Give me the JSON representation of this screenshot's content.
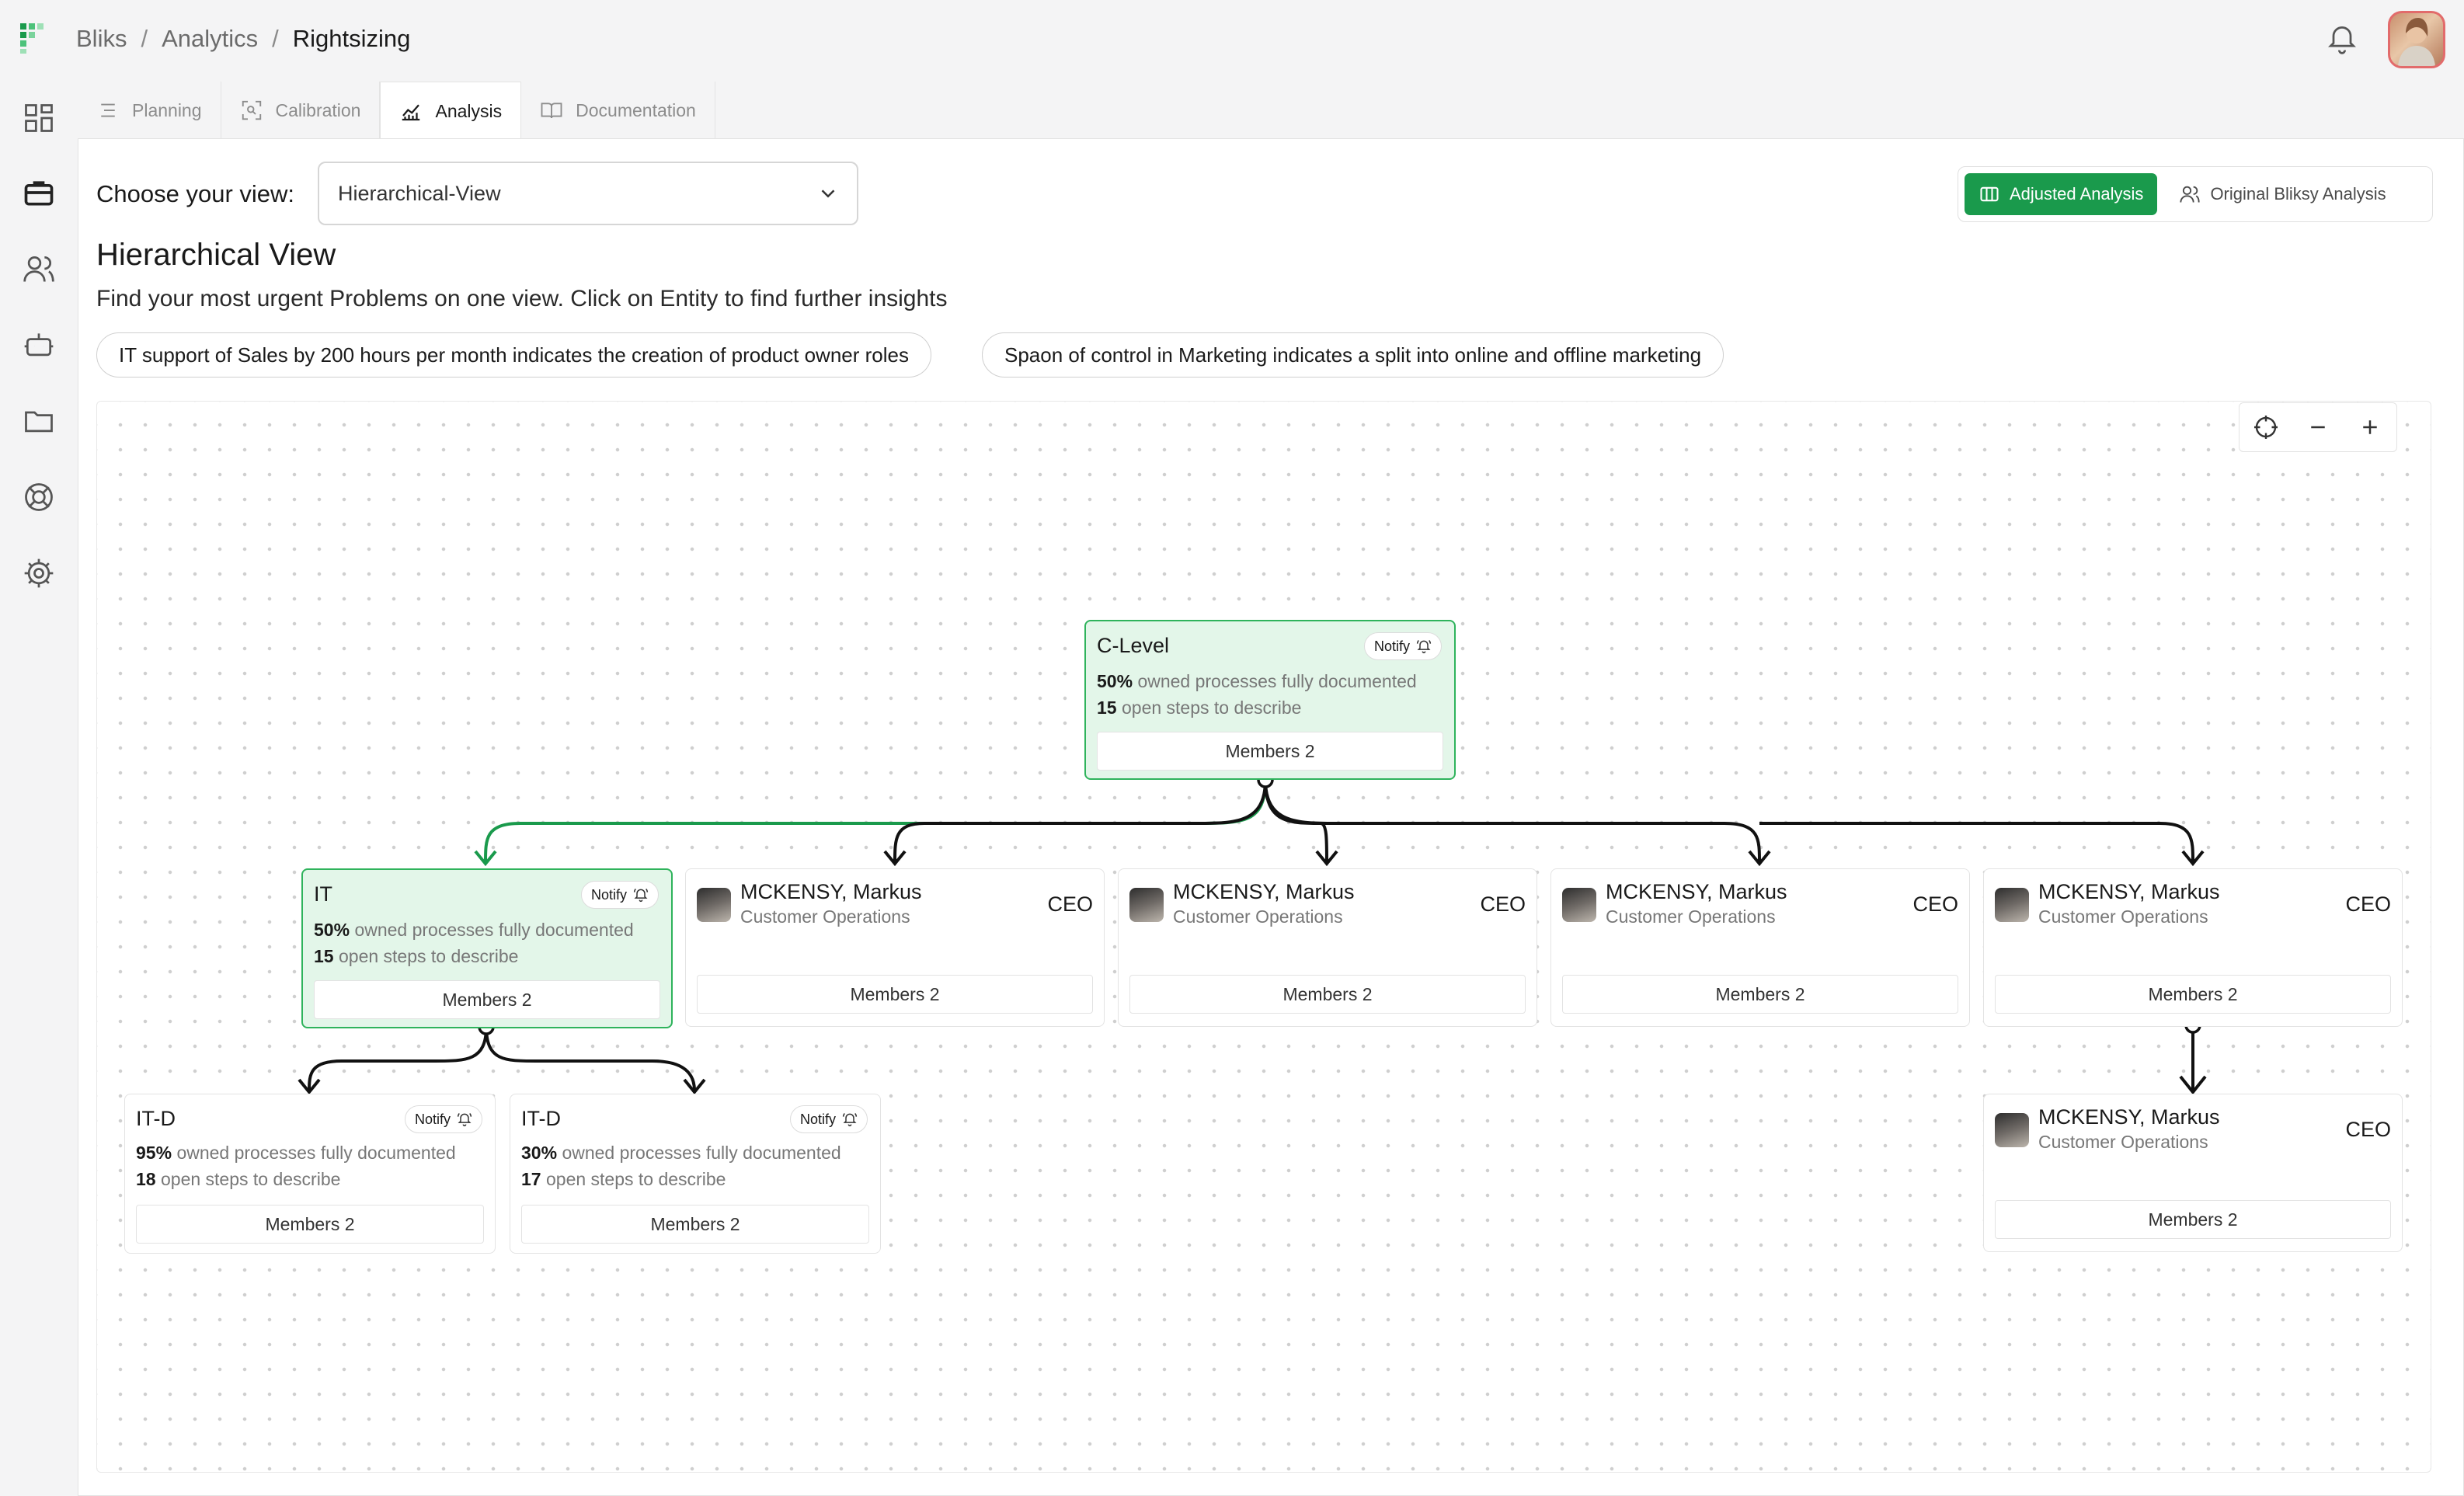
{
  "breadcrumb": {
    "items": [
      "Bliks",
      "Analytics"
    ],
    "current": "Rightsizing",
    "separator": "/"
  },
  "tabs": [
    {
      "label": "Planning",
      "icon": "list-icon",
      "active": false
    },
    {
      "label": "Calibration",
      "icon": "scan-icon",
      "active": false
    },
    {
      "label": "Analysis",
      "icon": "chart-icon",
      "active": true
    },
    {
      "label": "Documentation",
      "icon": "book-icon",
      "active": false
    }
  ],
  "sidebar": {
    "icons": [
      "dashboard-icon",
      "briefcase-icon",
      "users-icon",
      "bot-icon",
      "folder-icon",
      "lifebuoy-icon",
      "settings-icon"
    ]
  },
  "view": {
    "label": "Choose your view:",
    "selected": "Hierarchical-View"
  },
  "toggle": {
    "adjusted": "Adjusted Analysis",
    "original": "Original Bliksy Analysis"
  },
  "heading": "Hierarchical View",
  "subheading": "Find your most urgent Problems on one view. Click on Entity to find further insights",
  "insights": [
    "IT support of Sales by 200 hours per month indicates the creation of product owner roles",
    "Spaon of control in Marketing indicates a split into online and offline marketing"
  ],
  "colors": {
    "accent": "#1a9a4c",
    "node_green_bg": "#e3f6e9",
    "node_green_border": "#2fb35c"
  },
  "nodes": {
    "clevel": {
      "title": "C-Level",
      "notify": "Notify",
      "pct": "50%",
      "pct_text": "owned processes fully documented",
      "steps": "15",
      "steps_text": "open steps to describe",
      "members": "Members 2"
    },
    "it": {
      "title": "IT",
      "notify": "Notify",
      "pct": "50%",
      "pct_text": "owned processes fully documented",
      "steps": "15",
      "steps_text": "open steps to describe",
      "members": "Members 2"
    },
    "itd1": {
      "title": "IT-D",
      "notify": "Notify",
      "pct": "95%",
      "pct_text": "owned processes fully documented",
      "steps": "18",
      "steps_text": "open steps to describe",
      "members": "Members 2"
    },
    "itd2": {
      "title": "IT-D",
      "notify": "Notify",
      "pct": "30%",
      "pct_text": "owned processes fully documented",
      "steps": "17",
      "steps_text": "open steps to describe",
      "members": "Members 2"
    },
    "people": [
      {
        "name": "MCKENSY, Markus",
        "dept": "Customer Operations",
        "role": "CEO",
        "members": "Members 2"
      },
      {
        "name": "MCKENSY, Markus",
        "dept": "Customer Operations",
        "role": "CEO",
        "members": "Members 2"
      },
      {
        "name": "MCKENSY, Markus",
        "dept": "Customer Operations",
        "role": "CEO",
        "members": "Members 2"
      },
      {
        "name": "MCKENSY, Markus",
        "dept": "Customer Operations",
        "role": "CEO",
        "members": "Members 2"
      },
      {
        "name": "MCKENSY, Markus",
        "dept": "Customer Operations",
        "role": "CEO",
        "members": "Members 2"
      }
    ]
  }
}
